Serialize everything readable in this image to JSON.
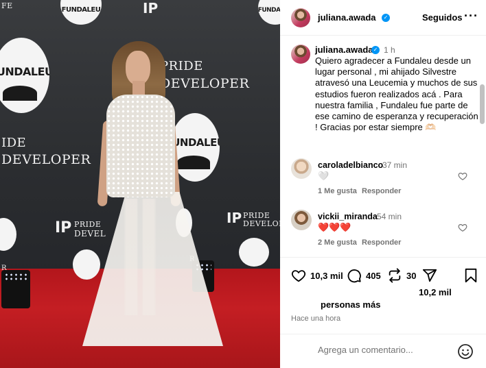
{
  "photo": {
    "brand_word_1": "FUNDALEU",
    "pride_word": "PRIDE",
    "developer_word": "DEVELOPER",
    "developer_cut": "DEVEL",
    "ip_mark": "IP",
    "fragment_fe": "FE",
    "fragment_ide": "IDE",
    "fragment_r": "R"
  },
  "header": {
    "username": "juliana.awada",
    "follow_status": "Seguidos",
    "more_label": "···"
  },
  "caption": {
    "username": "juliana.awada",
    "time": "1 h",
    "text": "Quiero agradecer a Fundaleu desde un lugar personal , mi ahijado Silvestre atravesó una Leucemia y muchos de sus estudios fueron realizados acá . Para nuestra familia , Fundaleu fue parte de ese camino de esperanza y recuperación ! Gracias por estar siempre 🫶🏻"
  },
  "comments": [
    {
      "username": "caroladelbianco",
      "time": "37 min",
      "text": "🤍",
      "likes": "1 Me gusta",
      "reply": "Responder"
    },
    {
      "username": "vickii_miranda",
      "time": "54 min",
      "text": "❤️❤️❤️",
      "likes": "2 Me gusta",
      "reply": "Responder"
    }
  ],
  "actions": {
    "likes_count": "10,3 mil",
    "comments_count": "405",
    "reposts_count": "30",
    "shares_count": "10,2 mil"
  },
  "likes_summary": "personas más",
  "posted_ago": "Hace una hora",
  "comment_box": {
    "placeholder": "Agrega un comentario..."
  },
  "colors": {
    "verified_blue": "#0095f6",
    "secondary_text": "#737373",
    "divider": "#efefef",
    "carpet_red": "#c41e23"
  }
}
